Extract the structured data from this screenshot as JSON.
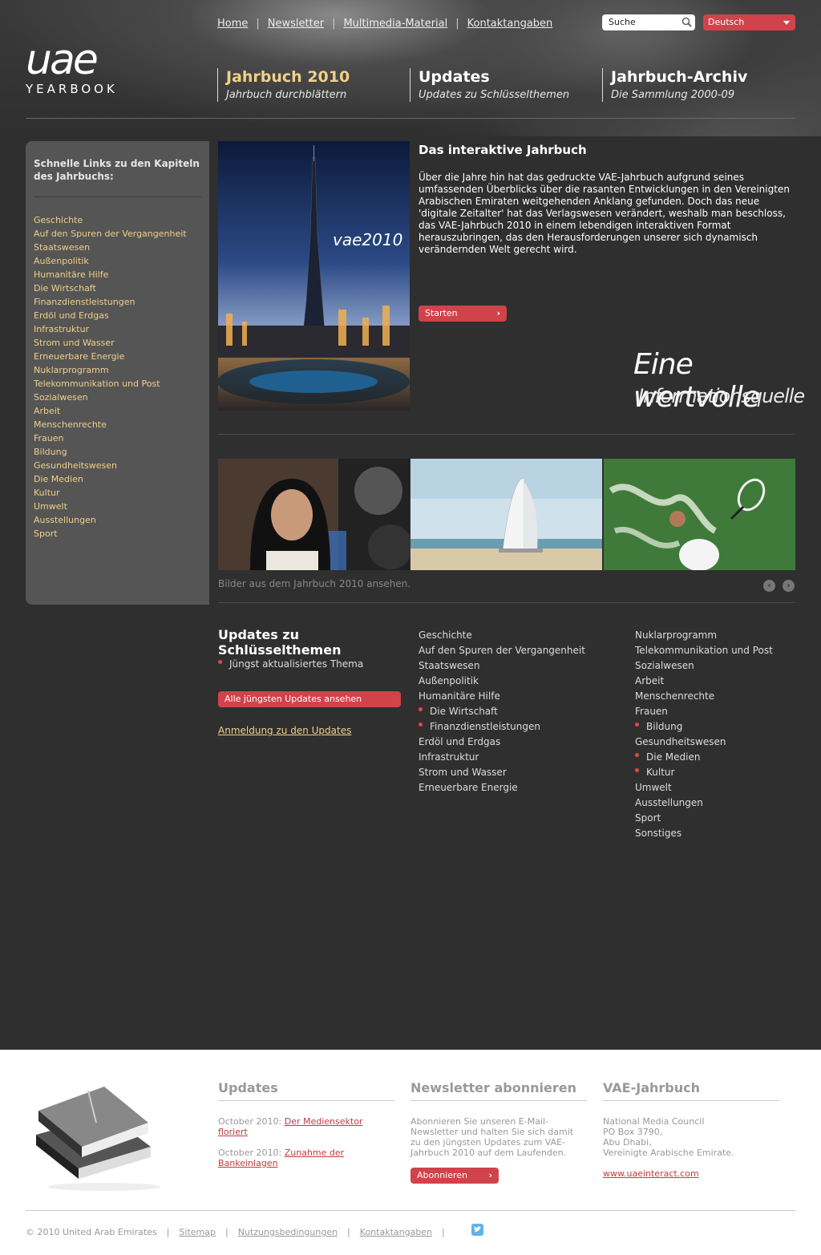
{
  "header": {
    "logo_main": "uae",
    "logo_sub": "YEARBOOK",
    "top_links": [
      "Home",
      "Newsletter",
      "Multimedia-Material",
      "Kontaktangaben"
    ],
    "search_value": "Suche",
    "language": "Deutsch",
    "nav": [
      {
        "title": "Jahrbuch 2010",
        "subtitle": "Jahrbuch durchblättern"
      },
      {
        "title": "Updates",
        "subtitle": "Updates zu Schlüsselthemen"
      },
      {
        "title": "Jahrbuch-Archiv",
        "subtitle": "Die Sammlung 2000-09"
      }
    ]
  },
  "sidebar": {
    "heading": "Schnelle Links zu den Kapiteln des Jahrbuchs:",
    "links": [
      "Geschichte",
      "Auf den Spuren der Vergangenheit",
      "Staatswesen",
      "Außenpolitik",
      "Humanitäre Hilfe",
      "Die Wirtschaft",
      "Finanzdienstleistungen",
      "Erdöl und Erdgas",
      "Infrastruktur",
      "Strom und Wasser",
      "Erneuerbare Energie",
      "Nuklarprogramm",
      "Telekommunikation und Post",
      "Sozialwesen",
      "Arbeit",
      "Menschenrechte",
      "Frauen",
      "Bildung",
      "Gesundheitswesen",
      "Die Medien",
      "Kultur",
      "Umwelt",
      "Ausstellungen",
      "Sport"
    ]
  },
  "feature": {
    "cover_label": "vae2010",
    "title": "Das interaktive Jahrbuch",
    "text": "Über die Jahre hin hat das gedruckte VAE-Jahrbuch aufgrund seines umfassenden Überblicks über die rasanten Entwicklungen in den Vereinigten Arabischen Emiraten weitgehenden Anklang gefunden. Doch das neue 'digitale Zeitalter' hat das Verlagswesen verändert, weshalb man beschloss, das VAE-Jahrbuch 2010 in einem lebendigen interaktiven Format herauszubringen, das den Herausforderungen unserer sich dynamisch verändernden Welt gerecht wird.",
    "start_button": "Starten",
    "quote_line1": "Eine wertvolle",
    "quote_line2": "Informationsquelle"
  },
  "gallery": {
    "caption": "Bilder aus dem Jahrbuch 2010 ansehen."
  },
  "updates": {
    "title": "Updates zu Schlüsselthemen",
    "latest_label": "Jüngst aktualisiertes Thema",
    "all_button": "Alle jüngsten Updates ansehen",
    "signup_link": "Anmeldung zu den Updates",
    "col1": [
      {
        "label": "Geschichte",
        "updated": false
      },
      {
        "label": "Auf den Spuren der Vergangenheit",
        "updated": false
      },
      {
        "label": "Staatswesen",
        "updated": false
      },
      {
        "label": "Außenpolitik",
        "updated": false
      },
      {
        "label": "Humanitäre Hilfe",
        "updated": false
      },
      {
        "label": "Die Wirtschaft",
        "updated": true
      },
      {
        "label": "Finanzdienstleistungen",
        "updated": true
      },
      {
        "label": "Erdöl und Erdgas",
        "updated": false
      },
      {
        "label": "Infrastruktur",
        "updated": false
      },
      {
        "label": "Strom und Wasser",
        "updated": false
      },
      {
        "label": "Erneuerbare Energie",
        "updated": false
      }
    ],
    "col2": [
      {
        "label": "Nuklarprogramm",
        "updated": false
      },
      {
        "label": "Telekommunikation und Post",
        "updated": false
      },
      {
        "label": "Sozialwesen",
        "updated": false
      },
      {
        "label": "Arbeit",
        "updated": false
      },
      {
        "label": "Menschenrechte",
        "updated": false
      },
      {
        "label": "Frauen",
        "updated": false
      },
      {
        "label": "Bildung",
        "updated": true
      },
      {
        "label": "Gesundheitswesen",
        "updated": false
      },
      {
        "label": "Die Medien",
        "updated": true
      },
      {
        "label": "Kultur",
        "updated": true
      },
      {
        "label": "Umwelt",
        "updated": false
      },
      {
        "label": "Ausstellungen",
        "updated": false
      },
      {
        "label": "Sport",
        "updated": false
      },
      {
        "label": "Sonstiges",
        "updated": false
      }
    ]
  },
  "footer": {
    "updates_title": "Updates",
    "news1_date": "October 2010:",
    "news1_link": "Der Mediensektor floriert",
    "news2_date": "October 2010:",
    "news2_link": "Zunahme der Bankeinlagen",
    "newsletter_title": "Newsletter abonnieren",
    "newsletter_text": "Abonnieren Sie unseren E-Mail-Newsletter und halten Sie sich damit zu den jüngsten Updates zum VAE-Jahrbuch 2010 auf dem Laufenden.",
    "subscribe_button": "Abonnieren",
    "yearbook_title": "VAE-Jahrbuch",
    "address_line1": "National Media Council",
    "address_line2": "PO Box 3790,",
    "address_line3": "Abu Dhabi,",
    "address_line4": "Vereinigte Arabische Emirate.",
    "website": "www.uaeinteract.com",
    "copyright": "© 2010 United Arab Emirates",
    "bottom_links": [
      "Sitemap",
      "Nutzungsbedingungen",
      "Kontaktangaben"
    ]
  },
  "colors": {
    "accent_red": "#d0434a",
    "link_yellow": "#f0d08a",
    "background": "#2f2f2f"
  }
}
